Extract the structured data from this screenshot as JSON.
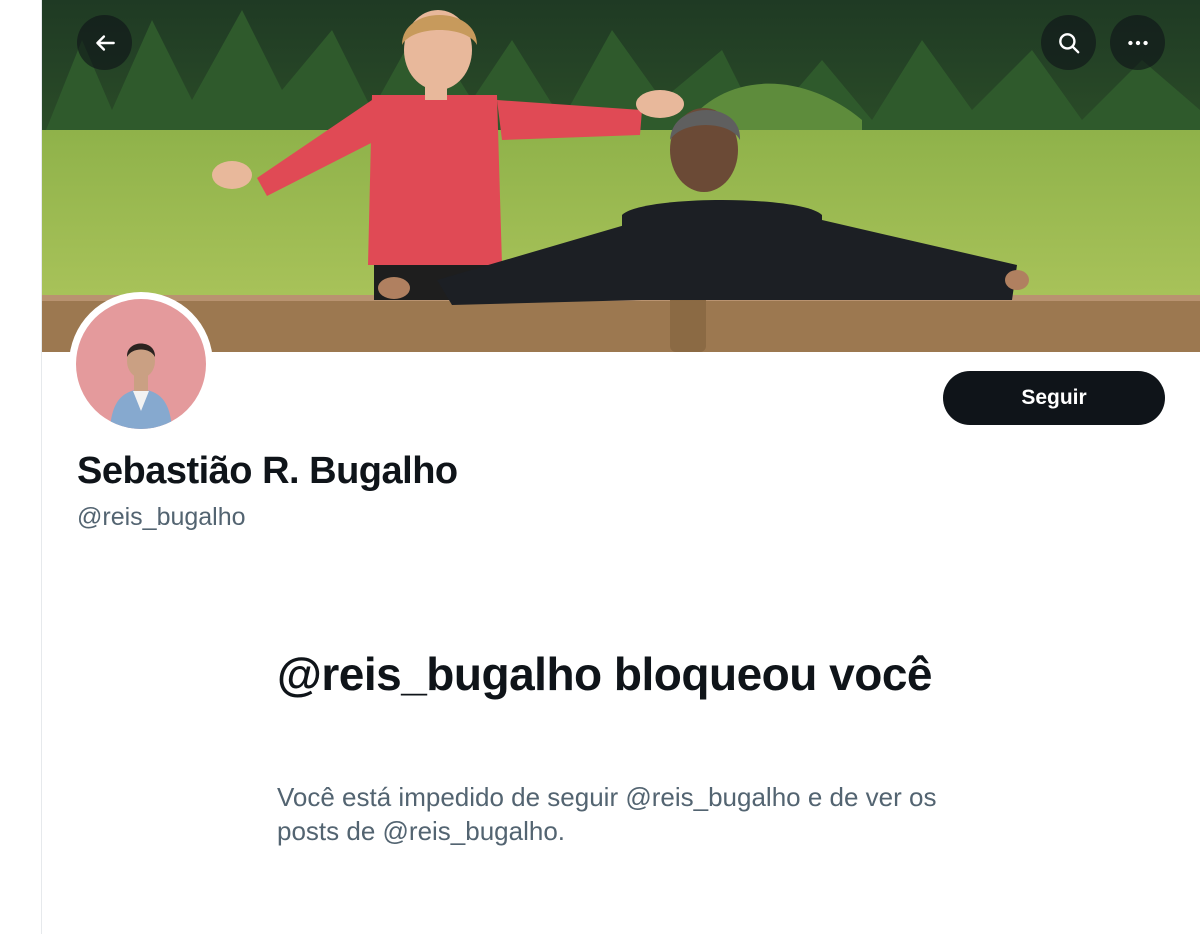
{
  "header": {
    "back_icon": "arrow-left-icon",
    "search_icon": "search-icon",
    "more_icon": "more-horizontal-icon"
  },
  "banner": {
    "description": "Profile header photo"
  },
  "profile": {
    "display_name": "Sebastião R. Bugalho",
    "handle": "@reis_bugalho",
    "follow_label": "Seguir"
  },
  "blocked": {
    "title": "@reis_bugalho bloqueou você",
    "description": "Você está impedido de seguir @reis_bugalho e de ver os posts de @reis_bugalho."
  },
  "colors": {
    "text_primary": "#0f1419",
    "text_secondary": "#536471",
    "button_bg": "#0f1419"
  }
}
